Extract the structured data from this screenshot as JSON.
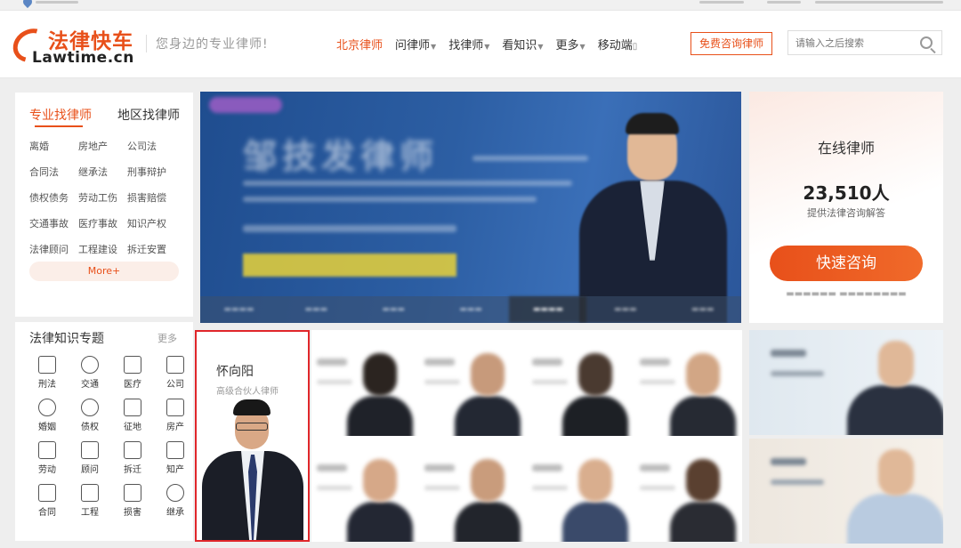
{
  "header": {
    "logo_cn": "法律快车",
    "logo_en": "Lawtime.cn",
    "slogan": "您身边的专业律师!",
    "nav": [
      {
        "label": "北京律师",
        "active": true,
        "caret": false
      },
      {
        "label": "问律师",
        "active": false,
        "caret": true
      },
      {
        "label": "找律师",
        "active": false,
        "caret": true
      },
      {
        "label": "看知识",
        "active": false,
        "caret": true
      },
      {
        "label": "更多",
        "active": false,
        "caret": true
      },
      {
        "label": "移动端",
        "active": false,
        "caret": false
      }
    ],
    "consult_button": "免费咨询律师",
    "search_placeholder": "请输入之后搜索"
  },
  "find_lawyer": {
    "tab_specialty": "专业找律师",
    "tab_region": "地区找律师",
    "categories": [
      "离婚",
      "房地产",
      "公司法",
      "合同法",
      "继承法",
      "刑事辩护",
      "债权债务",
      "劳动工伤",
      "损害赔偿",
      "交通事故",
      "医疗事故",
      "知识产权",
      "法律顾问",
      "工程建设",
      "拆迁安置"
    ],
    "more_label": "More+"
  },
  "topics": {
    "title": "法律知识专题",
    "more_label": "更多",
    "items": [
      {
        "label": "刑法",
        "icon": "book-icon"
      },
      {
        "label": "交通",
        "icon": "car-icon"
      },
      {
        "label": "医疗",
        "icon": "medical-kit-icon"
      },
      {
        "label": "公司",
        "icon": "building-icon"
      },
      {
        "label": "婚姻",
        "icon": "heart-icon"
      },
      {
        "label": "债权",
        "icon": "yen-coin-icon"
      },
      {
        "label": "征地",
        "icon": "grid-icon"
      },
      {
        "label": "房产",
        "icon": "house-icon"
      },
      {
        "label": "劳动",
        "icon": "shield-icon"
      },
      {
        "label": "顾问",
        "icon": "document-icon"
      },
      {
        "label": "拆迁",
        "icon": "demolition-icon"
      },
      {
        "label": "知产",
        "icon": "book-open-icon"
      },
      {
        "label": "合同",
        "icon": "contract-icon"
      },
      {
        "label": "工程",
        "icon": "yen-doc-icon"
      },
      {
        "label": "损害",
        "icon": "damage-icon"
      },
      {
        "label": "继承",
        "icon": "people-icon"
      }
    ]
  },
  "banner": {
    "title": "邹技发律师"
  },
  "online": {
    "title": "在线律师",
    "count": "23,510人",
    "subtitle": "提供法律咨询解答",
    "button": "快速咨询"
  },
  "featured_lawyer": {
    "name": "怀向阳",
    "title": "高级合伙人律师"
  },
  "colors": {
    "brand": "#e8501a",
    "highlight_border": "#e0262a"
  }
}
